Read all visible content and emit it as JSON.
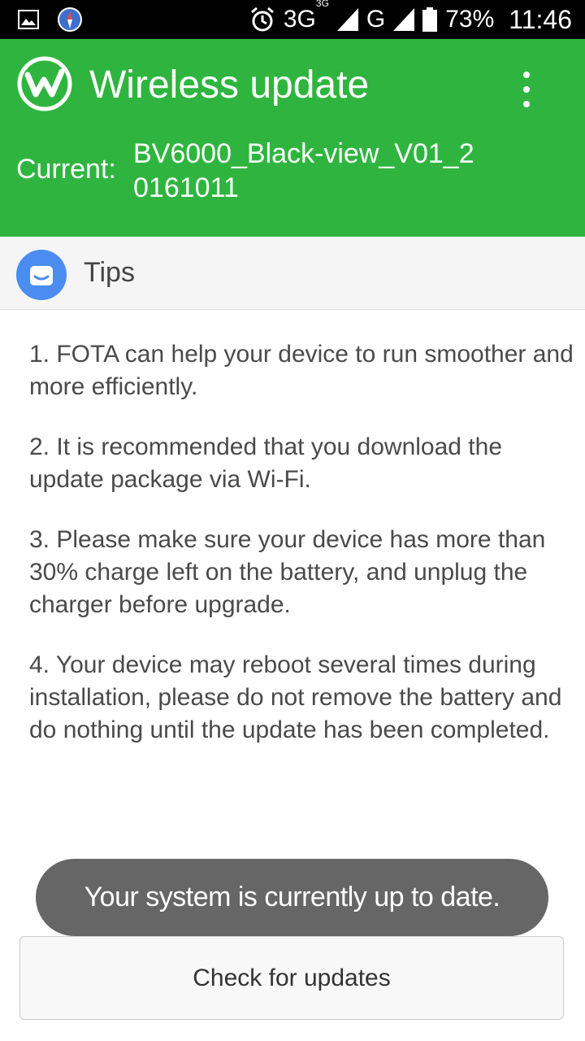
{
  "status_bar": {
    "network_primary": "3G",
    "network_superscript": "3G",
    "network_secondary": "G",
    "battery_percent": "73%",
    "time": "11:46",
    "icons": [
      "image-icon",
      "compass-icon",
      "alarm-icon",
      "signal-icon",
      "battery-icon"
    ]
  },
  "header": {
    "title": "Wireless update",
    "current_label": "Current:",
    "current_version": "BV6000_Black-view_V01_20161011",
    "background_color": "#2fb53f",
    "logo_icon": "wireless-update-logo-icon",
    "menu_icon": "more-vertical-icon"
  },
  "tips": {
    "title": "Tips",
    "icon": "smile-face-icon",
    "items": [
      "1. FOTA can help your device to run smoother and more efficiently.",
      "2. It is recommended that you download the update package via Wi-Fi.",
      "3. Please make sure your device has more than 30% charge left on the battery, and unplug the charger before upgrade.",
      "4. Your device may reboot several times during installation, please do not remove the battery and do nothing until the update has been completed."
    ]
  },
  "toast": {
    "message": "Your system is currently up to date."
  },
  "actions": {
    "check_button_label": "Check for updates"
  }
}
